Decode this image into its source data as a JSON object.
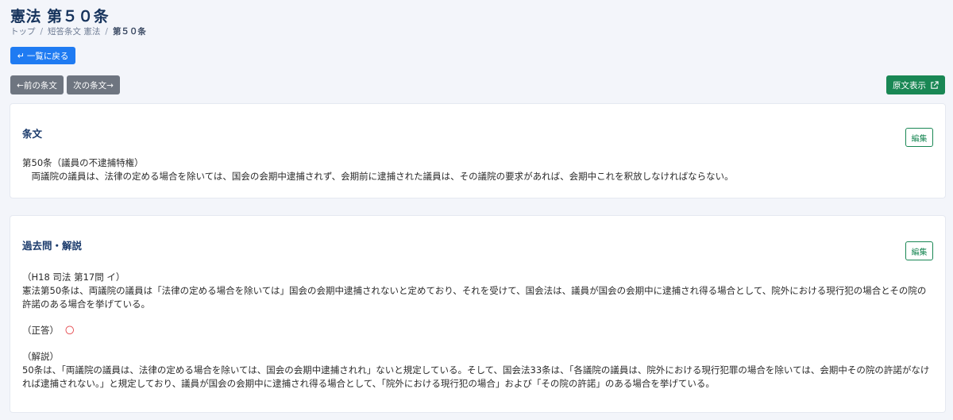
{
  "header": {
    "title": "憲法 第５０条",
    "breadcrumb": [
      "トップ",
      "短答条文 憲法",
      "第５０条"
    ]
  },
  "nav": {
    "back_label": "一覧に戻る",
    "back_icon": "return-arrow-icon",
    "prev_label": "←前の条文",
    "next_label": "次の条文→",
    "original_label": "原文表示",
    "original_icon": "external-link-icon"
  },
  "article_card": {
    "title": "条文",
    "edit_label": "編集",
    "heading": "第50条（議員の不逮捕特権）",
    "text": "　両議院の議員は、法律の定める場合を除いては、国会の会期中逮捕されず、会期前に逮捕された議員は、その議院の要求があれば、会期中これを釈放しなければならない。"
  },
  "past_card": {
    "title": "過去問・解説",
    "edit_label": "編集",
    "question_ref": "（H18 司法 第17問 イ）",
    "question_text": "憲法第50条は、両議院の議員は「法律の定める場合を除いては」国会の会期中逮捕されないと定めており、それを受けて、国会法は、議員が国会の会期中に逮捕され得る場合として、院外における現行犯の場合とその院の許諾のある場合を挙げている。",
    "answer_label": "（正答）",
    "answer_mark": "〇",
    "explanation_label": "（解説）",
    "explanation_text": "50条は、「両議院の議員は、法律の定める場合を除いては、国会の会期中逮捕されれ」ないと規定している。そして、国会法33条は、「各議院の議員は、院外における現行犯罪の場合を除いては、会期中その院の許諾がなければ逮捕されない。」と規定しており、議員が国会の会期中に逮捕され得る場合として、「院外における現行犯の場合」および「その院の許諾」のある場合を挙げている。"
  },
  "colors": {
    "primary": "#1f7bf2",
    "secondary": "#6e7580",
    "success": "#198754",
    "answer": "#e5484d",
    "title": "#16335c"
  }
}
